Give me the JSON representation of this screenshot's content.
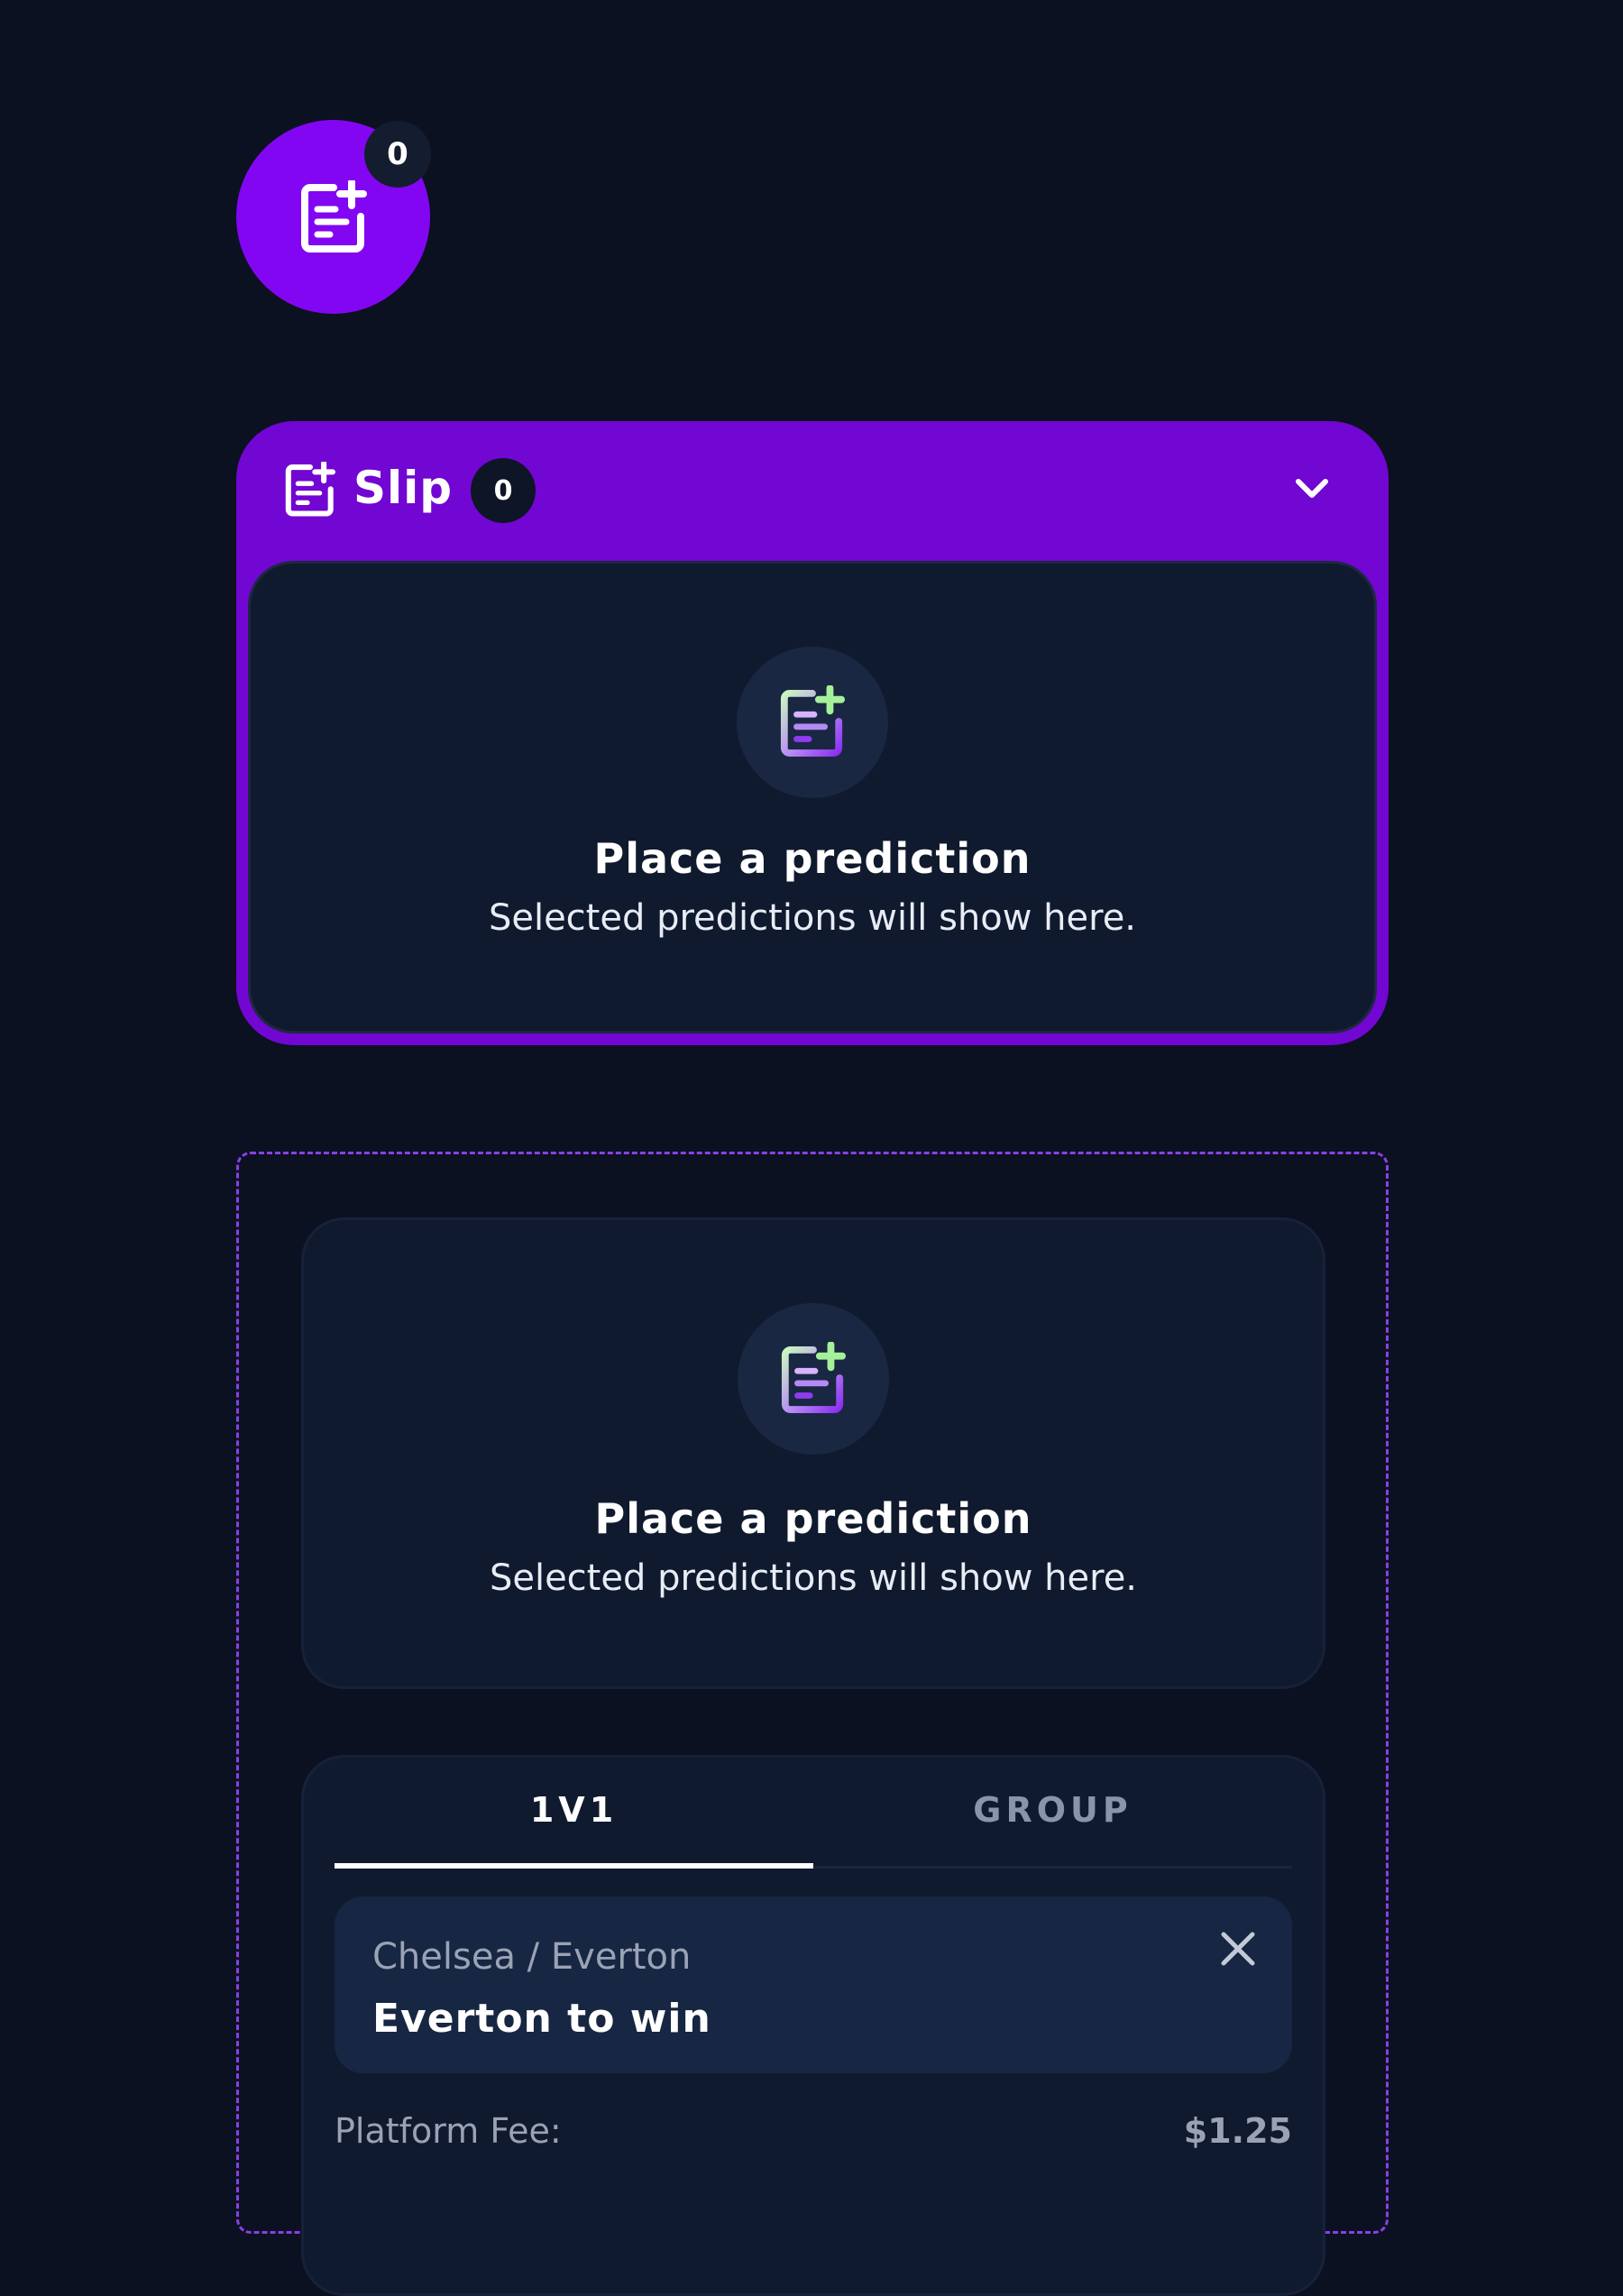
{
  "fab": {
    "count": "0",
    "icon": "slip-add-icon"
  },
  "slip": {
    "title": "Slip",
    "count": "0",
    "toggle_icon": "chevron-down-icon",
    "empty_title": "Place a prediction",
    "empty_subtitle": "Selected predictions will show here."
  },
  "expanded": {
    "empty_title": "Place a prediction",
    "empty_subtitle": "Selected predictions will show here.",
    "tabs": [
      {
        "label": "1V1",
        "active": true
      },
      {
        "label": "GROUP",
        "active": false
      }
    ],
    "pick": {
      "match": "Chelsea / Everton",
      "selection": "Everton to win"
    },
    "fee": {
      "label": "Platform Fee:",
      "value": "$1.25"
    }
  },
  "colors": {
    "background": "#0b1120",
    "accent": "#8206f2",
    "slip_header": "#7206d2",
    "card": "#101a2e",
    "dashed_border": "#8b3ee8"
  }
}
